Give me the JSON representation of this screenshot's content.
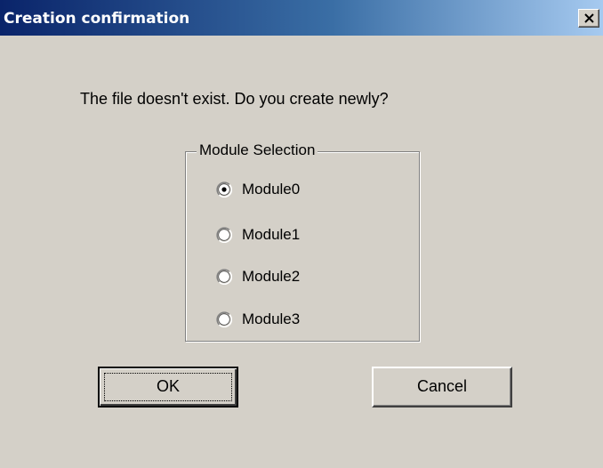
{
  "window": {
    "title": "Creation confirmation",
    "close_glyph": "×",
    "titlebar_colors": [
      "#0a246a",
      "#3a6ea5",
      "#a6caf0"
    ]
  },
  "dialog": {
    "message": "The file doesn't exist. Do you create newly?",
    "module_selection": {
      "legend": "Module Selection",
      "options": [
        {
          "label": "Module0",
          "selected": true
        },
        {
          "label": "Module1",
          "selected": false
        },
        {
          "label": "Module2",
          "selected": false
        },
        {
          "label": "Module3",
          "selected": false
        }
      ]
    },
    "buttons": {
      "ok_label": "OK",
      "cancel_label": "Cancel"
    }
  },
  "icons": {
    "close": "close-icon",
    "radio": "radio-button-icon"
  },
  "colors": {
    "face": "#d4d0c8",
    "shadow": "#808080",
    "highlight": "#ffffff",
    "text": "#000000"
  }
}
